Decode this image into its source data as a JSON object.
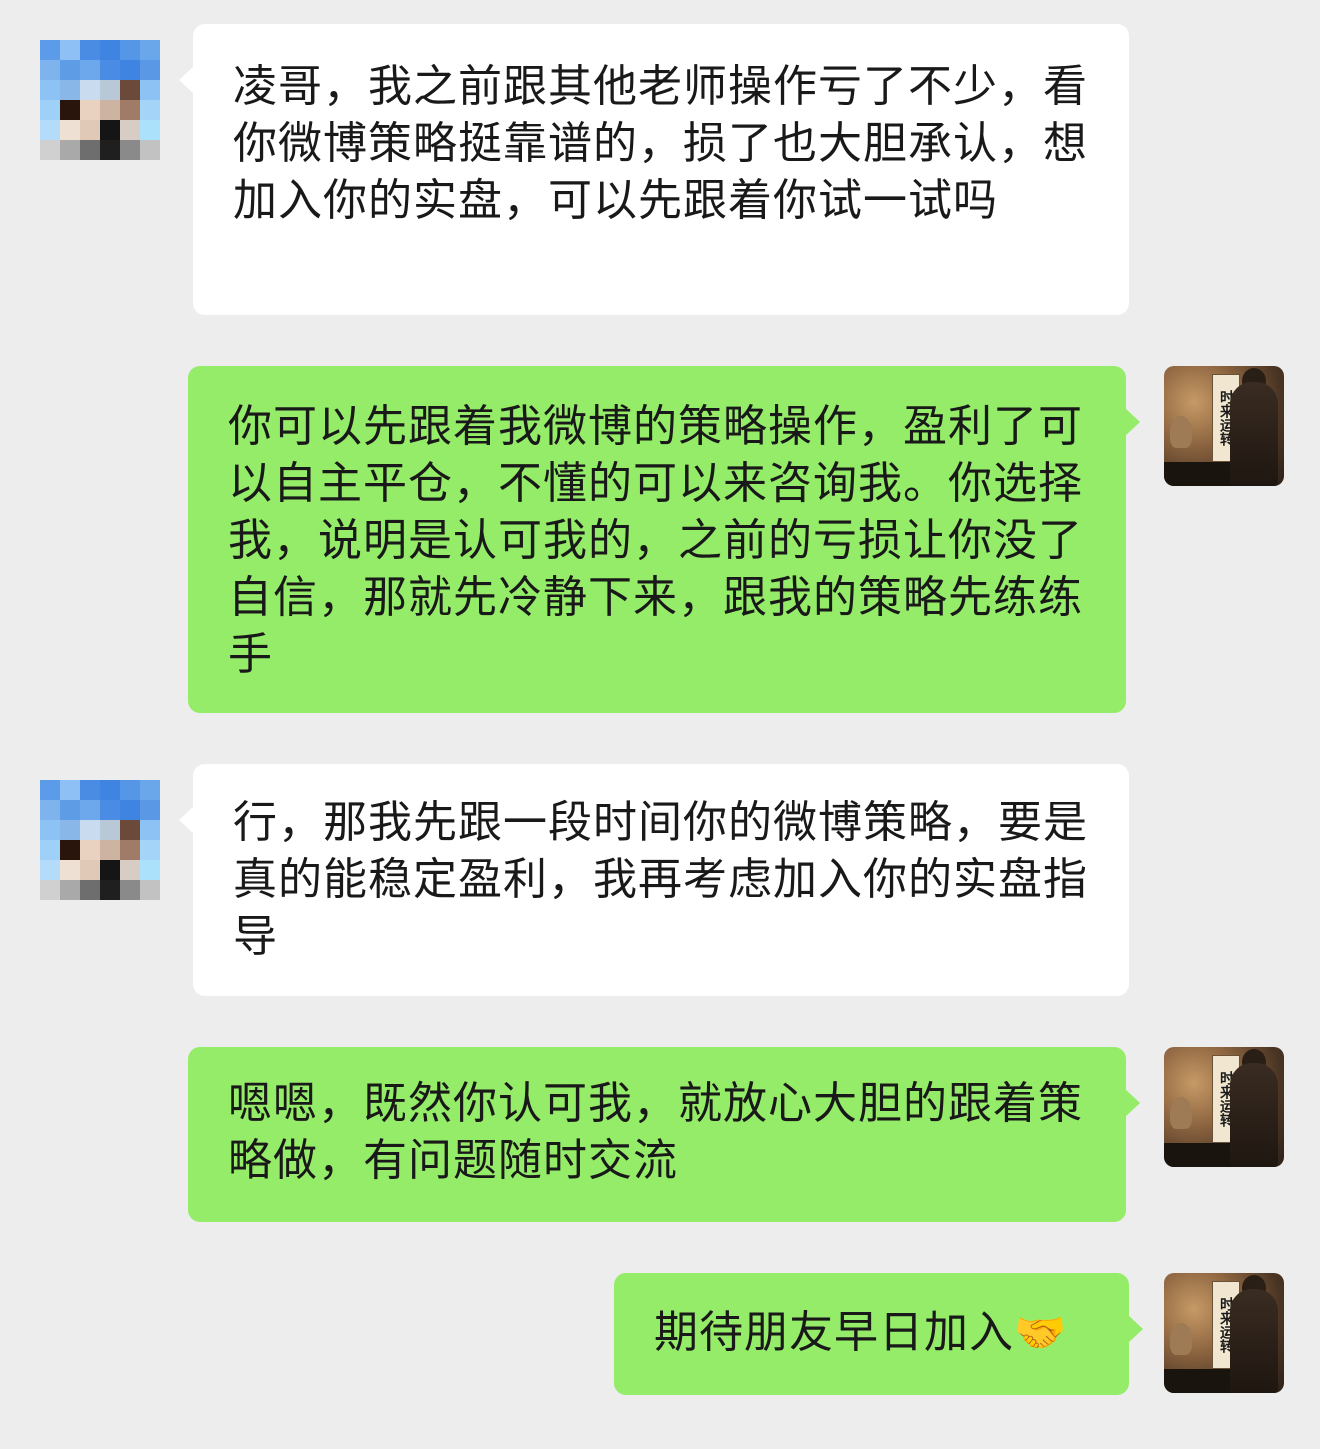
{
  "chat": {
    "messages": [
      {
        "direction": "incoming",
        "text": "凌哥，我之前跟其他老师操作亏了不少，看你微博策略挺靠谱的，损了也大胆承认，想加入你的实盘，可以先跟着你试一试吗"
      },
      {
        "direction": "outgoing",
        "text": "你可以先跟着我微博的策略操作，盈利了可以自主平仓，不懂的可以来咨询我。你选择我，说明是认可我的，之前的亏损让你没了自信，那就先冷静下来，跟我的策略先练练手"
      },
      {
        "direction": "incoming",
        "text": "行，那我先跟一段时间你的微博策略，要是真的能稳定盈利，我再考虑加入你的实盘指导"
      },
      {
        "direction": "outgoing",
        "text": "嗯嗯，既然你认可我，就放心大胆的跟着策略做，有问题随时交流"
      },
      {
        "direction": "outgoing",
        "text": "期待朋友早日加入",
        "emoji": "🤝"
      }
    ],
    "self_avatar": {
      "scroll_text": "时来运转"
    }
  },
  "colors": {
    "background": "#ededed",
    "incoming_bubble": "#ffffff",
    "outgoing_bubble": "#95ec69",
    "text": "#191919"
  }
}
